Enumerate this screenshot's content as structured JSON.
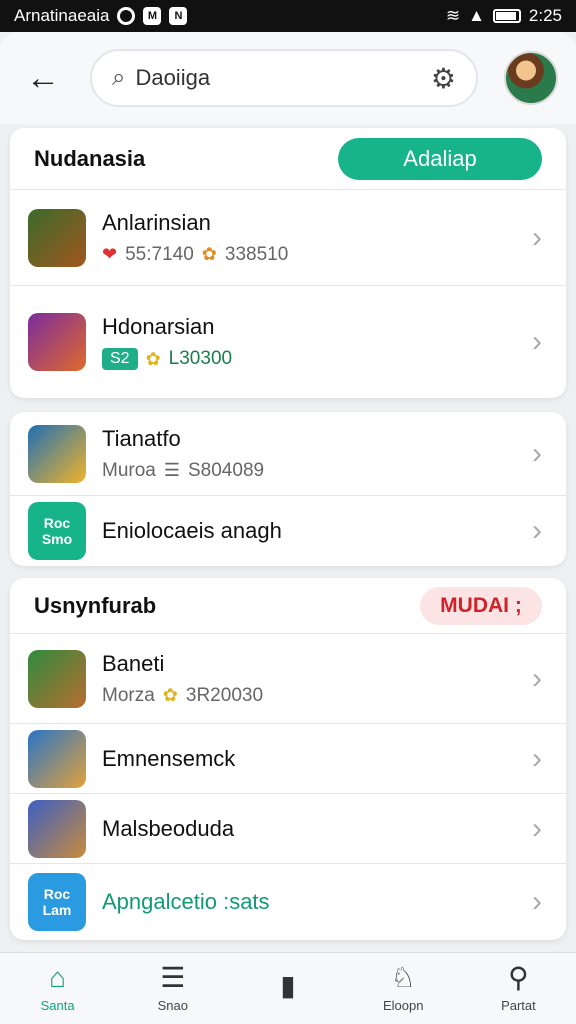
{
  "status_bar": {
    "carrier": "Arnatinaeaia",
    "time": "2:25"
  },
  "header": {
    "search_value": "Daoiiga"
  },
  "cards": [
    {
      "title": "Nudanasia",
      "pill": "Adaliap",
      "items": [
        {
          "name": "Anlarinsian",
          "meta1": "55:7140",
          "meta2": "338510"
        },
        {
          "name": "Hdonarsian",
          "meta1": "S2",
          "meta2": "L30300"
        }
      ]
    },
    {
      "items": [
        {
          "name": "Tianatfo",
          "meta1": "Muroa",
          "meta2": "S804089"
        },
        {
          "name": "Eniolocaeis anagh",
          "icon_text": "Roc Smo"
        }
      ]
    },
    {
      "title": "Usnynfurab",
      "pill": "MUDAI ;",
      "items": [
        {
          "name": "Baneti",
          "meta1": "Morza",
          "meta2": "3R20030"
        },
        {
          "name": "Emnensemck"
        },
        {
          "name": "Malsbeoduda"
        },
        {
          "name": "Apngalcetio :sats",
          "icon_text": "Roc Lam"
        }
      ]
    }
  ],
  "bottom_nav": [
    {
      "label": "Santa"
    },
    {
      "label": "Snao"
    },
    {
      "label": ""
    },
    {
      "label": "Eloopn"
    },
    {
      "label": "Partat"
    }
  ],
  "colors": {
    "accent": "#17b48b",
    "danger": "#d1222a"
  }
}
